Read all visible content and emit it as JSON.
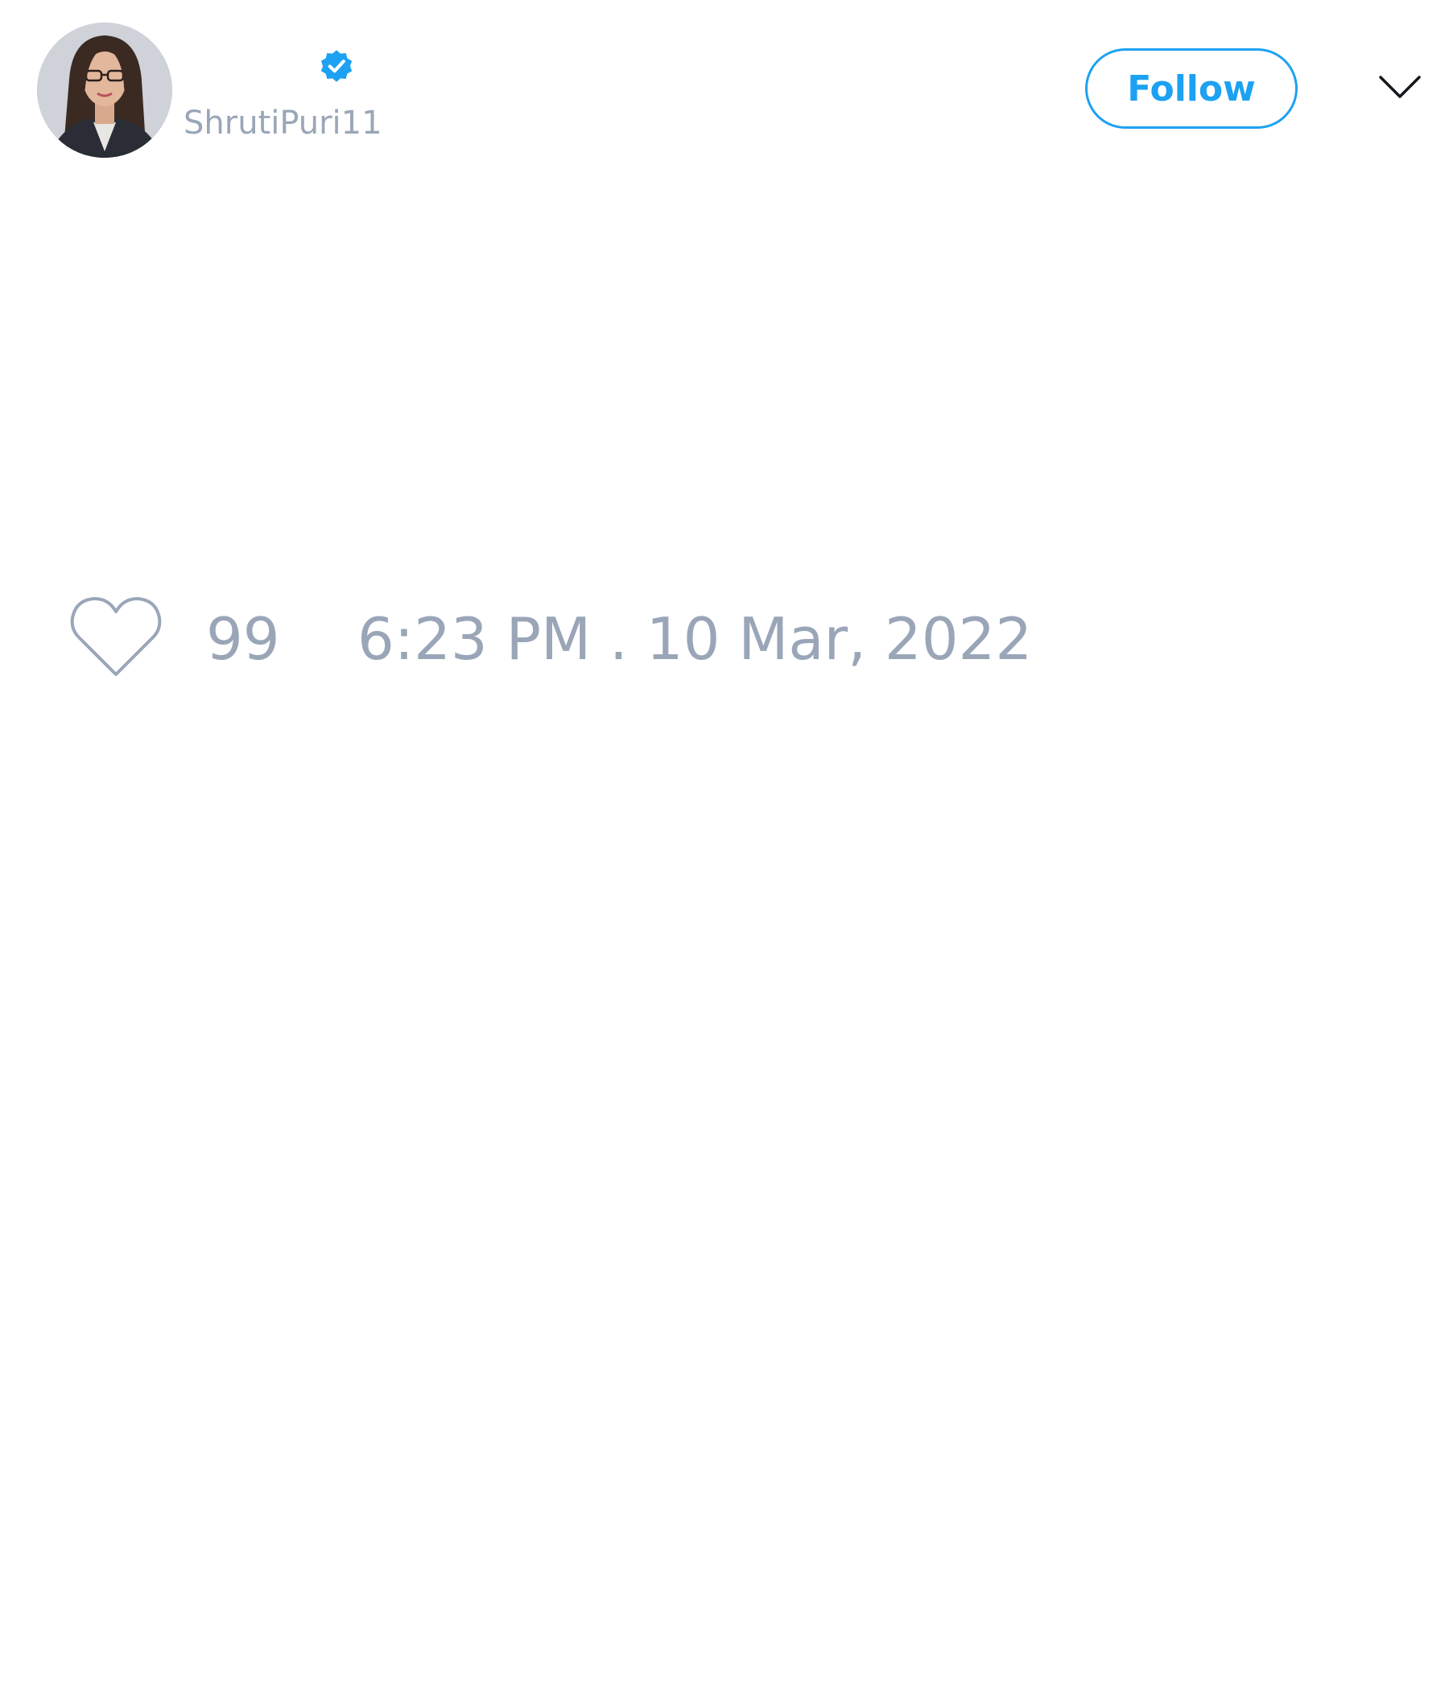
{
  "header": {
    "handle": "ShrutiPuri11",
    "verified": true,
    "follow_label": "Follow",
    "menu_icon": "chevron-down-icon"
  },
  "footer": {
    "like_icon": "heart-icon",
    "like_count": "99",
    "timestamp": "6:23 PM . 10 Mar, 2022"
  },
  "colors": {
    "accent": "#1da1f2",
    "muted_text": "#9aa6b8",
    "background": "#ffffff"
  }
}
